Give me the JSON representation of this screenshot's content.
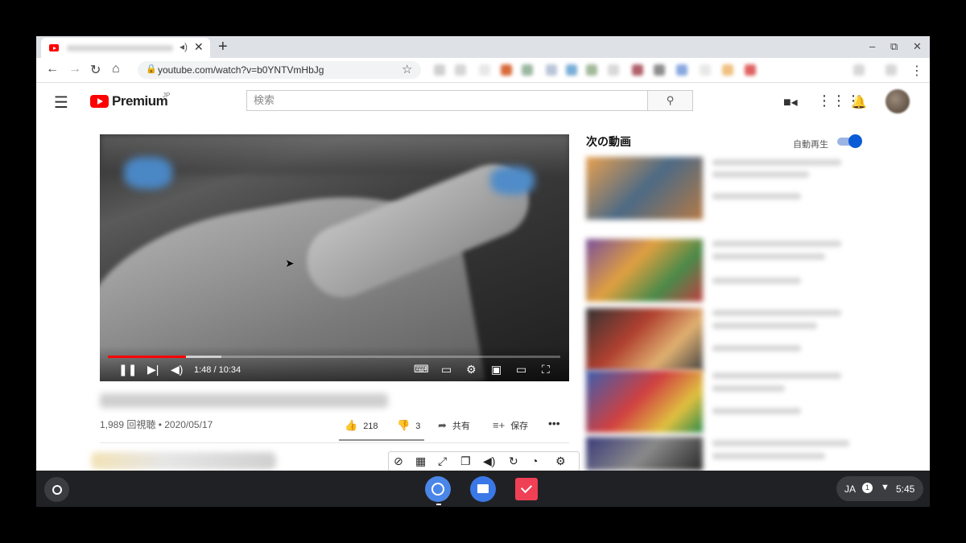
{
  "browser": {
    "tab": {
      "close_glyph": "✕",
      "audio_icon": "speaker-icon"
    },
    "new_tab_glyph": "+",
    "window_controls": [
      "‒",
      "⧉",
      "✕"
    ],
    "url": "youtube.com/watch?v=b0YNTVmHbJg"
  },
  "youtube": {
    "logo_text": "Premium",
    "region": "JP",
    "search_placeholder": "検索",
    "brand_color": "#ff0000"
  },
  "player": {
    "time": "1:48 / 10:34",
    "progress": 0.172,
    "buffered": 0.25
  },
  "video_info": {
    "views_date": "1,989 回視聴 • 2020/05/17",
    "likes": "218",
    "dislikes": "3",
    "share_label": "共有",
    "save_label": "保存"
  },
  "sidebar": {
    "title": "次の動画",
    "autoplay_label": "自動再生",
    "autoplay_on": true
  },
  "shelf": {
    "ime": "JA",
    "notifications": "1",
    "clock": "5:45"
  }
}
